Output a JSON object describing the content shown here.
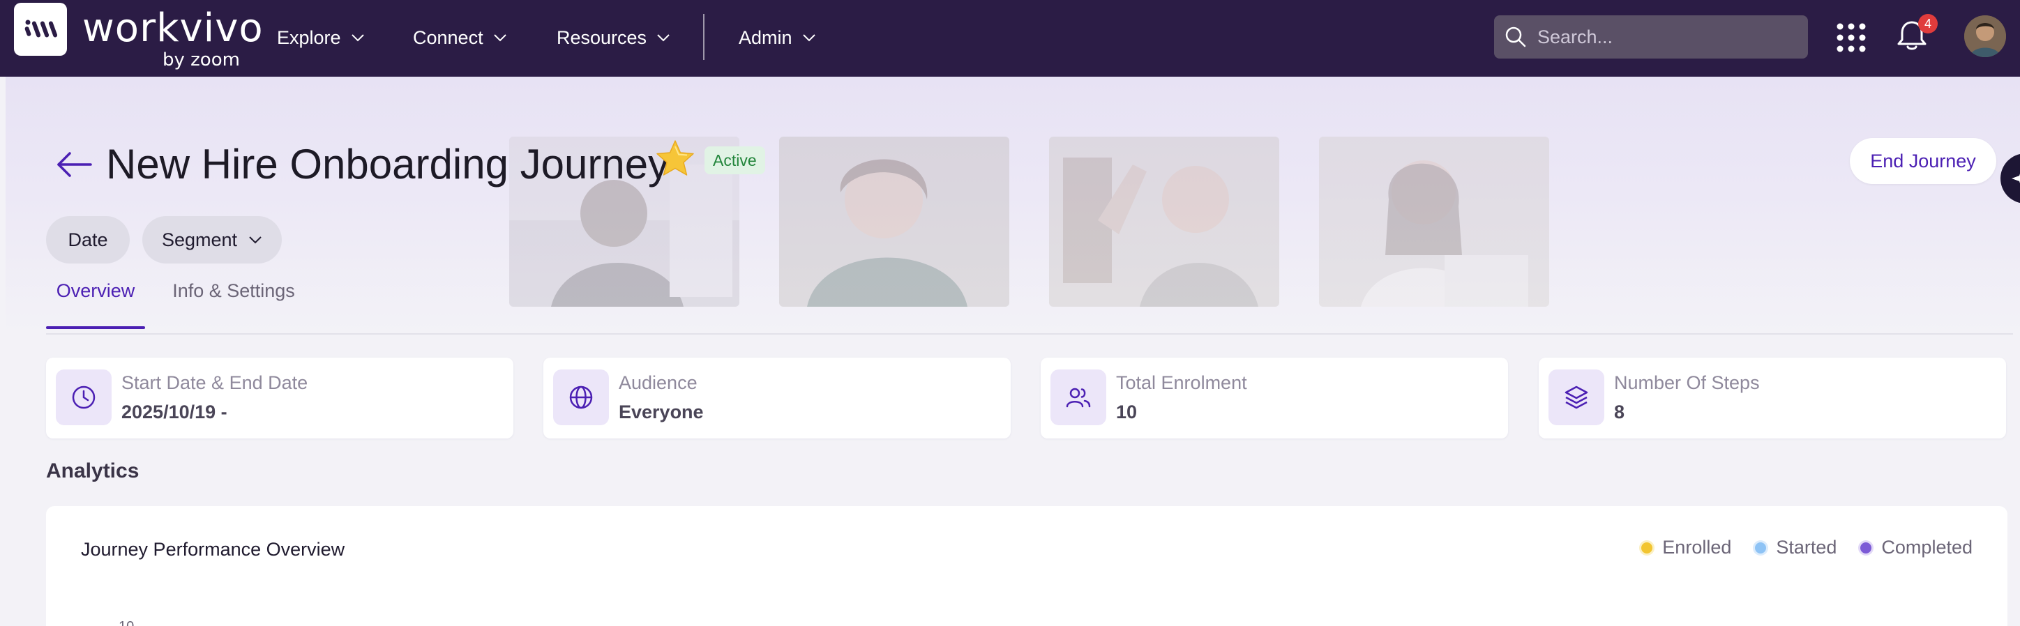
{
  "navbar": {
    "brand_name": "workvivo",
    "brand_sub": "by zoom",
    "items": [
      {
        "label": "Explore"
      },
      {
        "label": "Connect"
      },
      {
        "label": "Resources"
      },
      {
        "label": "Admin"
      }
    ],
    "search_placeholder": "Search...",
    "notifications_count": "4"
  },
  "page": {
    "title": "New Hire Onboarding Journey",
    "status": "Active",
    "end_button": "End Journey",
    "filters": [
      {
        "label": "Date",
        "icon": "none"
      },
      {
        "label": "Segment",
        "icon": "chevron-down-icon"
      }
    ],
    "tabs": [
      {
        "label": "Overview",
        "active": true
      },
      {
        "label": "Info & Settings",
        "active": false
      }
    ]
  },
  "stats": [
    {
      "label": "Start Date & End Date",
      "value": "2025/10/19 -",
      "icon": "clock-icon"
    },
    {
      "label": "Audience",
      "value": "Everyone",
      "icon": "globe-icon"
    },
    {
      "label": "Total Enrolment",
      "value": "10",
      "icon": "users-icon"
    },
    {
      "label": "Number Of Steps",
      "value": "8",
      "icon": "layers-icon"
    }
  ],
  "analytics": {
    "section_title": "Analytics",
    "chart_title": "Journey Performance Overview",
    "legend": [
      {
        "label": "Enrolled",
        "color": "#f2c531"
      },
      {
        "label": "Started",
        "color": "#8ec3f5"
      },
      {
        "label": "Completed",
        "color": "#7c5ad6"
      }
    ],
    "first_tick": "10"
  },
  "colors": {
    "nav_bg": "#2b1c45",
    "accent": "#4b1fb3",
    "active_badge_bg": "#e1f3e5",
    "active_badge_text": "#22853b"
  }
}
